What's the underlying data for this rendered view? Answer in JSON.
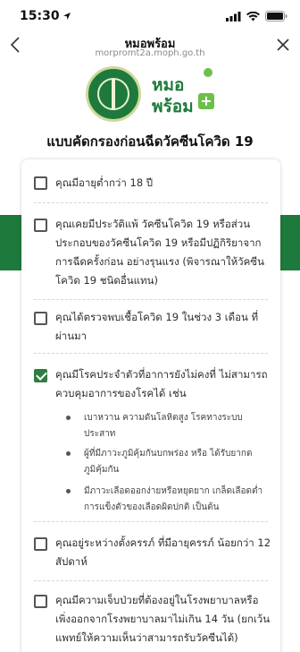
{
  "status_bar": {
    "time": "15:30",
    "location_icon": "location-arrow-icon",
    "signal_icon": "cellular-signal-icon",
    "wifi_icon": "wifi-icon",
    "battery_icon": "battery-icon"
  },
  "header": {
    "title": "หมอพร้อม",
    "url": "morpromt2a.moph.go.th",
    "back_icon": "chevron-left-icon",
    "close_icon": "close-icon"
  },
  "logos": {
    "moph_seal": "moph-seal-logo",
    "app_logo_line1": "หมอ",
    "app_logo_line2": "พร้อม"
  },
  "form": {
    "title": "แบบคัดกรองก่อนฉีดวัคซีนโควิด 19",
    "questions": [
      {
        "text": "คุณมีอายุต่ำกว่า 18 ปี",
        "checked": false
      },
      {
        "text": "คุณเคยมีประวัติแพ้ วัคซีนโควิด 19 หรือส่วนประกอบของวัคซีนโควิด 19 หรือมีปฏิกิริยาจากการฉีดครั้งก่อน อย่างรุนแรง (พิจารณาให้วัคซีนโควิด 19 ชนิดอื่นแทน)",
        "checked": false
      },
      {
        "text": "คุณได้ตรวจพบเชื้อโควิด 19 ในช่วง 3 เดือน ที่ผ่านมา",
        "checked": false
      },
      {
        "text": "คุณมีโรคประจำตัวที่อาการยังไม่คงที่ ไม่สามารถควบคุมอาการของโรคได้ เช่น",
        "checked": true,
        "bullets": [
          "เบาหวาน ความดันโลหิตสูง โรคทางระบบประสาท",
          "ผู้ที่มีภาวะภูมิคุ้มกันบกพร่อง หรือ ได้รับยากดภูมิคุ้มกัน",
          "มีภาวะเลือดออกง่ายหรือหยุดยาก เกล็ดเลือดต่ำ การแข็งตัวของเลือดผิดปกติ เป็นต้น"
        ]
      },
      {
        "text": "คุณอยู่ระหว่างตั้งครรภ์ ที่มีอายุครรภ์ น้อยกว่า 12 สัปดาห์",
        "checked": false
      },
      {
        "text": "คุณมีความเจ็บป่วยที่ต้องอยู่ในโรงพยาบาลหรือเพิ่งออกจากโรงพยาบาลมาไม่เกิน 14 วัน (ยกเว้นแพทย์ให้ความเห็นว่าสามารถรับวัคซีนได้)",
        "checked": false
      }
    ]
  },
  "colors": {
    "brand_green": "#1e7a3c",
    "check_green": "#2f7d40",
    "accent_light_green": "#6cc04a"
  }
}
